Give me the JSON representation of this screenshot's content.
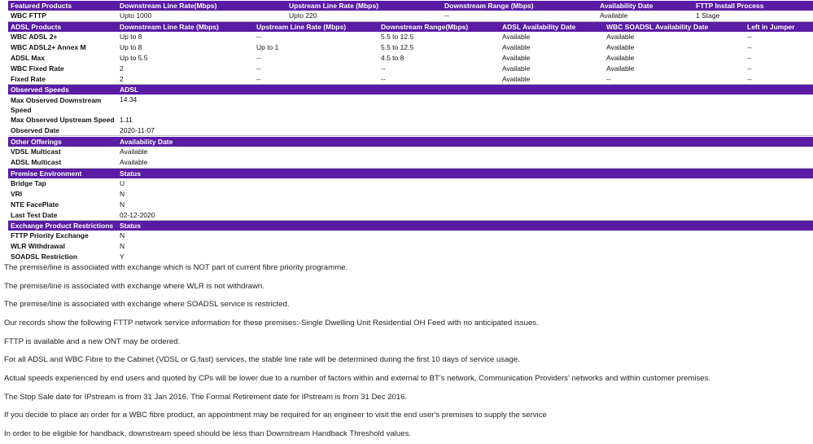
{
  "featured": {
    "headers": [
      "Featured Products",
      "Downstream Line Rate(Mbps)",
      "Upstream Line Rate (Mbps)",
      "Downstream Range (Mbps)",
      "Availability Date",
      "FTTP Install Process"
    ],
    "rows": [
      [
        "WBC FTTP",
        "Upto 1000",
        "Upto 220",
        "--",
        "Available",
        "1 Stage"
      ]
    ]
  },
  "adsl_products": {
    "headers": [
      "ADSL Products",
      "Downstream Line Rate (Mbps)",
      "Upstream Line Rate (Mbps)",
      "Downstream Range(Mbps)",
      "ADSL Availability Date",
      "WBC SOADSL Availability Date",
      "Left in Jumper"
    ],
    "rows": [
      [
        "WBC ADSL 2+",
        "Up to 8",
        "--",
        "5.5 to 12.5",
        "Available",
        "Available",
        "--"
      ],
      [
        "WBC ADSL2+ Annex M",
        "Up to 8",
        "Up to 1",
        "5.5 to 12.5",
        "Available",
        "Available",
        "--"
      ],
      [
        "ADSL Max",
        "Up to 5.5",
        "--",
        "4.5 to 8",
        "Available",
        "Available",
        "--"
      ],
      [
        "WBC Fixed Rate",
        "2",
        "--",
        "--",
        "Available",
        "Available",
        "--"
      ],
      [
        "Fixed Rate",
        "2",
        "--",
        "--",
        "Available",
        "--",
        "--"
      ]
    ]
  },
  "observed_speeds": {
    "headers": [
      "Observed Speeds",
      "ADSL"
    ],
    "rows": [
      [
        "Max Observed Downstream Speed",
        "14.34"
      ],
      [
        "Max Observed Upstream Speed",
        "1.11"
      ],
      [
        "Observed Date",
        "2020-11-07"
      ]
    ]
  },
  "other_offerings": {
    "headers": [
      "Other Offerings",
      "Availability Date"
    ],
    "rows": [
      [
        "VDSL Multicast",
        "Available"
      ],
      [
        "ADSL Multicast",
        "Available"
      ]
    ]
  },
  "premise_environment": {
    "headers": [
      "Premise Environment",
      "Status"
    ],
    "rows": [
      [
        "Bridge Tap",
        "U"
      ],
      [
        "VRI",
        "N"
      ],
      [
        "NTE FacePlate",
        "N"
      ],
      [
        "Last Test Date",
        "02-12-2020"
      ]
    ]
  },
  "exchange_restrictions": {
    "headers": [
      "Exchange Product Restrictions",
      "Status"
    ],
    "rows": [
      [
        "FTTP Priority Exchange",
        "N"
      ],
      [
        "WLR Withdrawal",
        "N"
      ],
      [
        "SOADSL Restriction",
        "Y"
      ]
    ]
  },
  "notes": [
    "The premise/line is associated with exchange which is NOT part of current fibre priority programme.",
    "The premise/line is associated with exchange where WLR is not withdrawn.",
    "The premise/line is associated with exchange where SOADSL service is restricted.",
    "Our records show the following FTTP network service information for these premises:-Single Dwelling Unit Residential OH Feed with no anticipated issues.",
    "FTTP is available and a new ONT may be ordered.",
    "For all ADSL and WBC Fibre to the Cabinet (VDSL or G.fast) services, the stable line rate will be determined during the first 10 days of service usage.",
    "Actual speeds experienced by end users and quoted by CPs will be lower due to a number of factors within and external to BT's network, Communication Providers' networks and within customer premises.",
    "The Stop Sale date for IPstream is from 31 Jan 2016. The Formal Retirement date for IPstream is from 31 Dec 2016.",
    "If you decide to place an order for a WBC fibre product, an appointment may be required for an engineer to visit the end user's premises to supply the service",
    "In order to be eligible for handback, downstream speed should be less than Downstream Handback Threshold values."
  ]
}
